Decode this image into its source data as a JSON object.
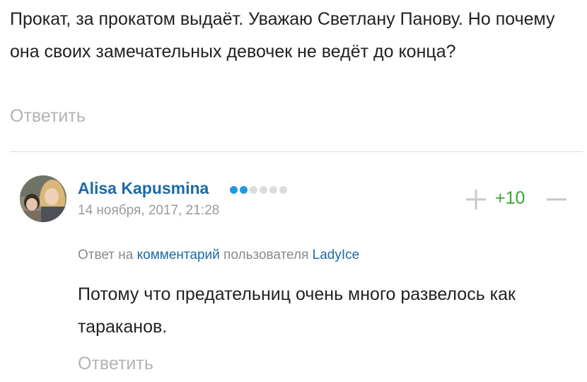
{
  "previous_comment": {
    "text": "Прокат, за прокатом выдаёт. Уважаю Светлану Панову. Но почему она своих замечательных девочек не ведёт до конца?",
    "reply_label": "Ответить"
  },
  "comment": {
    "author": "Alisa Kapusmina",
    "rating_dots": {
      "filled": 2,
      "total": 6,
      "filled_color": "#1e9be0",
      "empty_color": "#dddddd"
    },
    "date": "14 ноября, 2017, 21:28",
    "score": "+10",
    "vote_up_icon": "plus-icon",
    "vote_down_icon": "minus-icon",
    "reply_to": {
      "prefix": "Ответ на ",
      "link": "комментарий",
      "middle": " пользователя ",
      "user": "LadyIce"
    },
    "text": "Потому что предательниц очень много развелось как тараканов.",
    "reply_label": "Ответить"
  },
  "colors": {
    "link": "#1a6aa6",
    "muted": "#b3b3b3",
    "score_positive": "#3aa53a"
  }
}
